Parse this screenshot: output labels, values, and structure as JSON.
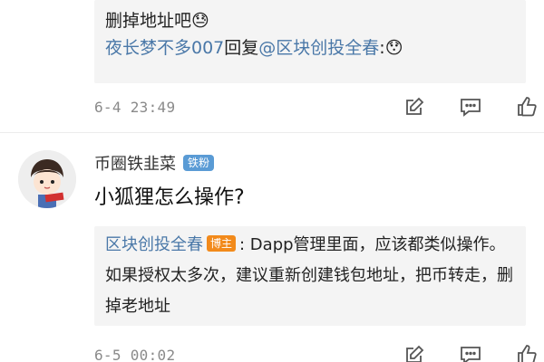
{
  "top_reply": {
    "line1": "…",
    "line2": "删掉地址吧😓",
    "reply_author": "夜长梦不多007",
    "reply_word": "回复",
    "reply_target": "@区块创投全春",
    "reply_suffix": ":😯"
  },
  "meta1": {
    "time": "6-4 23:49"
  },
  "comment": {
    "username": "币圈铁韭菜",
    "fan_badge": "铁粉",
    "text": "小狐狸怎么操作?"
  },
  "blogger_reply": {
    "author": "区块创投全春",
    "badge": "博主",
    "text": ": Dapp管理里面，应该都类似操作。如果授权太多次，建议重新创建钱包地址，把币转走，删掉老地址"
  },
  "meta2": {
    "time": "6-5 00:02"
  },
  "colors": {
    "link": "#4a78a8",
    "fan_badge": "#5a9bd5",
    "blogger_badge": "#f28a1b"
  },
  "icons": [
    "edit-icon",
    "comment-icon",
    "like-icon"
  ]
}
